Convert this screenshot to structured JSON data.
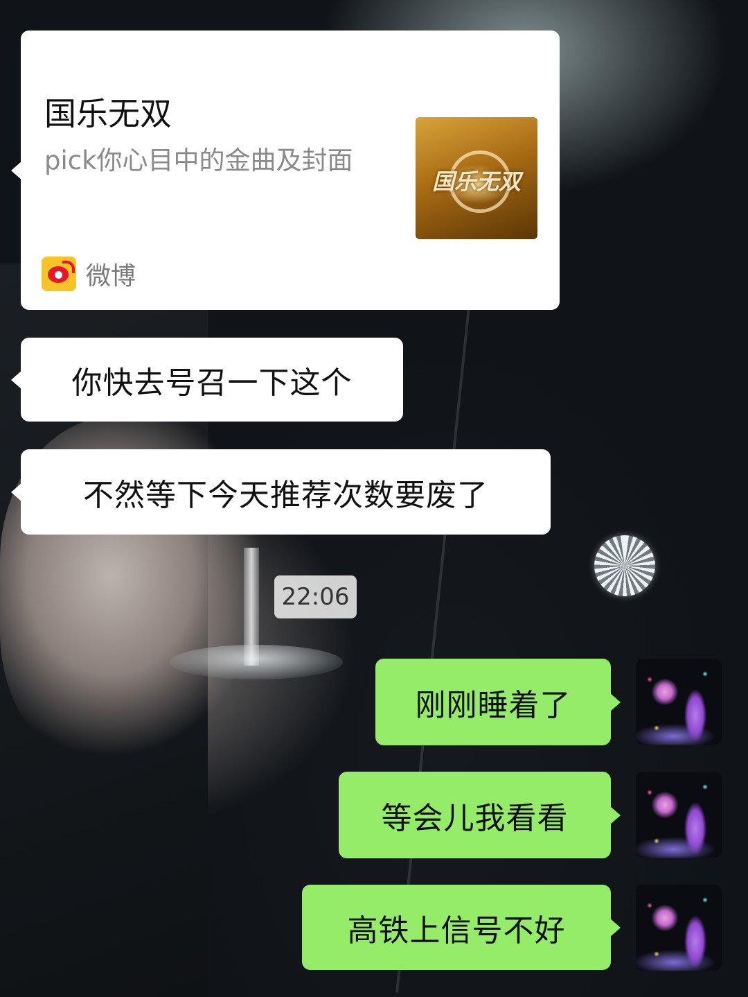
{
  "share_card": {
    "title": "国乐无双",
    "description": "pick你心目中的金曲及封面",
    "thumbnail_logo_text": "国乐无双",
    "source_name": "微博",
    "source_icon": "weibo-icon"
  },
  "messages_incoming": [
    {
      "text": "你快去号召一下这个"
    },
    {
      "text": "不然等下今天推荐次数要废了"
    }
  ],
  "timestamp": "22:06",
  "messages_outgoing": [
    {
      "text": "刚刚睡着了"
    },
    {
      "text": "等会儿我看看"
    },
    {
      "text": "高铁上信号不好"
    }
  ],
  "colors": {
    "incoming_bubble": "#ffffff",
    "outgoing_bubble": "#95ec69",
    "timestamp_chip": "#ebebeb",
    "weibo_yellow": "#f7c428",
    "weibo_red": "#e6162d"
  }
}
